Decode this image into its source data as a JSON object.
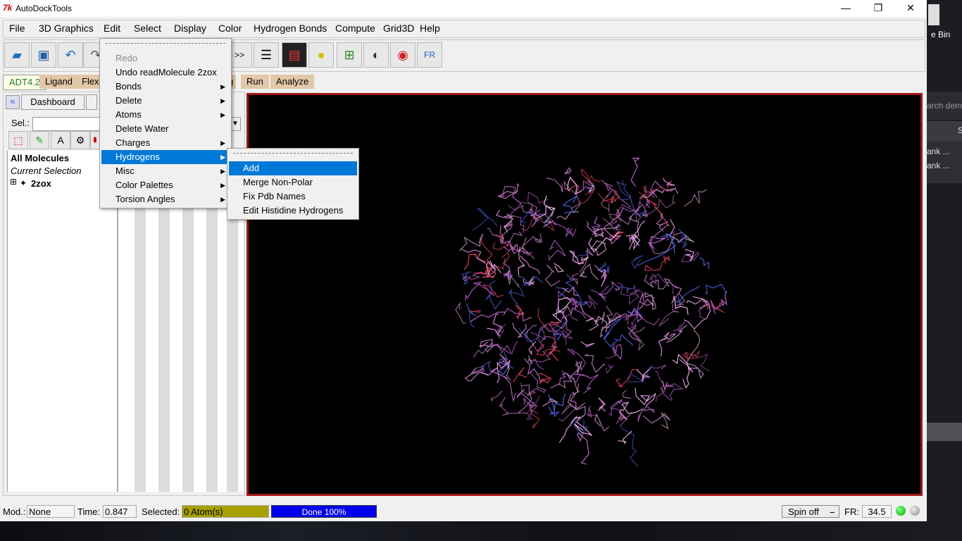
{
  "app": {
    "title": "AutoDockTools",
    "icon": "tk-feather-icon"
  },
  "window_controls": {
    "minimize": "—",
    "maximize": "❐",
    "close": "✕"
  },
  "desktop": {
    "recycle_label": "e Bin",
    "search_text": "arch dem",
    "col_s": "S",
    "row1": "ank ...",
    "row2": "ank ..."
  },
  "menubar": [
    "File",
    "3D Graphics",
    "Edit",
    "Select",
    "Display",
    "Color",
    "Hydrogen Bonds",
    "Compute",
    "Grid3D",
    "Help"
  ],
  "toolbar_icons": [
    "open-folder-icon",
    "save-icon",
    "undo-arrow-icon",
    "redo-arrow-icon",
    "python-shell-icon",
    "text-align-icon",
    "display-panel-icon",
    "color-shapes-icon",
    "network-editor-icon",
    "stereo-glasses-icon",
    "trackball-icon",
    "fr-info-icon"
  ],
  "tabs": {
    "adt": "ADT4.2",
    "ligand": "Ligand",
    "flex": "Flex",
    "g": "g",
    "run": "Run",
    "analyze": "Analyze"
  },
  "dashboard": {
    "tab_label": "Dashboard",
    "sel_label": "Sel.:",
    "sel_value": "",
    "tree_root": "All Molecules",
    "current_selection": "Current Selection",
    "molecule": "2zox",
    "expand": "⊞"
  },
  "edit_menu": {
    "items": [
      {
        "label": "Redo",
        "disabled": true,
        "submenu": false
      },
      {
        "label": "Undo readMolecule 2zox",
        "disabled": false,
        "submenu": false
      },
      {
        "label": "Bonds",
        "disabled": false,
        "submenu": true
      },
      {
        "label": "Delete",
        "disabled": false,
        "submenu": true
      },
      {
        "label": "Atoms",
        "disabled": false,
        "submenu": true
      },
      {
        "label": "Delete Water",
        "disabled": false,
        "submenu": false
      },
      {
        "label": "Charges",
        "disabled": false,
        "submenu": true
      },
      {
        "label": "Hydrogens",
        "disabled": false,
        "submenu": true,
        "selected": true
      },
      {
        "label": "Misc",
        "disabled": false,
        "submenu": true
      },
      {
        "label": "Color Palettes",
        "disabled": false,
        "submenu": true
      },
      {
        "label": "Torsion Angles",
        "disabled": false,
        "submenu": true
      }
    ]
  },
  "hydrogens_menu": {
    "items": [
      {
        "label": "Add",
        "selected": true
      },
      {
        "label": "Merge Non-Polar"
      },
      {
        "label": "Fix Pdb Names"
      },
      {
        "label": "Edit Histidine Hydrogens"
      }
    ]
  },
  "status": {
    "mod_label": "Mod.:",
    "mod_value": "None",
    "time_label": "Time:",
    "time_value": "0.847",
    "selected_label": "Selected:",
    "selected_value": "0 Atom(s)",
    "progress_text": "Done 100%",
    "progress": 1.0,
    "spin": "Spin off",
    "fr_label": "FR:",
    "fr_value": "34.5"
  },
  "colors": {
    "progress": "#0000ee",
    "selected_bg": "#a6a000",
    "menu_highlight": "#0078d7",
    "viewer_border": "#a01818"
  }
}
